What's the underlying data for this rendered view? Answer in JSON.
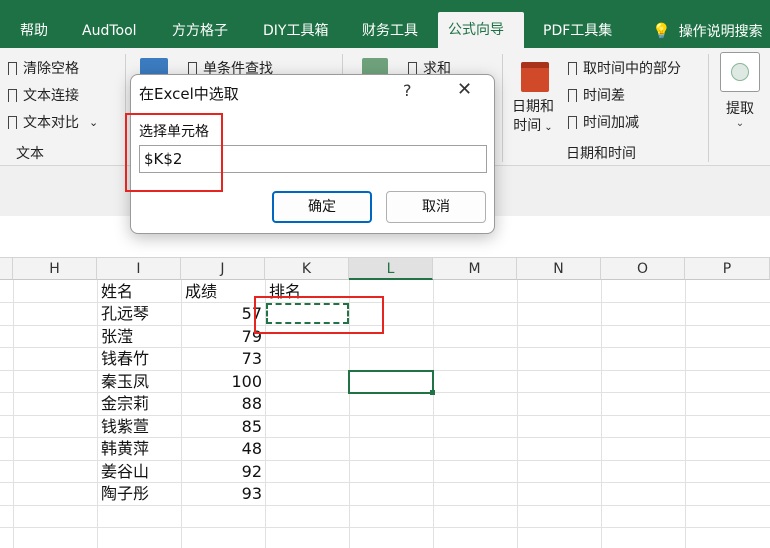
{
  "tabs": [
    {
      "label": "帮助"
    },
    {
      "label": "AudTool"
    },
    {
      "label": "方方格子"
    },
    {
      "label": "DIY工具箱"
    },
    {
      "label": "财务工具"
    },
    {
      "label": "公式向导"
    },
    {
      "label": "PDF工具集"
    },
    {
      "label": "操作说明搜索"
    }
  ],
  "ribbon": {
    "text_group": {
      "items": [
        "清除空格",
        "文本连接",
        "文本对比"
      ],
      "label": "文本"
    },
    "lookup": "单条件查找",
    "sum": "求和",
    "date_button": {
      "line1": "日期和",
      "line2": "时间"
    },
    "date_items": [
      "取时间中的部分",
      "时间差",
      "时间加减"
    ],
    "date_group_label": "日期和时间",
    "extract": "提取"
  },
  "dialog": {
    "title": "在Excel中选取",
    "help": "?",
    "close": "✕",
    "field_label": "选择单元格",
    "field_value": "$K$2",
    "ok": "确定",
    "cancel": "取消"
  },
  "columns": [
    "H",
    "I",
    "J",
    "K",
    "L",
    "M",
    "N",
    "O",
    "P"
  ],
  "headers": {
    "name": "姓名",
    "score": "成绩",
    "rank": "排名"
  },
  "rows": [
    {
      "name": "孔远琴",
      "score": "57"
    },
    {
      "name": "张滢",
      "score": "79"
    },
    {
      "name": "钱春竹",
      "score": "73"
    },
    {
      "name": "秦玉凤",
      "score": "100"
    },
    {
      "name": "金宗莉",
      "score": "88"
    },
    {
      "name": "钱紫萱",
      "score": "85"
    },
    {
      "name": "韩黄萍",
      "score": "48"
    },
    {
      "name": "姜谷山",
      "score": "92"
    },
    {
      "name": "陶子彤",
      "score": "93"
    }
  ],
  "colors": {
    "excel_green": "#1e7145",
    "highlight_red": "#e52620",
    "accent_blue": "#0067c0"
  }
}
